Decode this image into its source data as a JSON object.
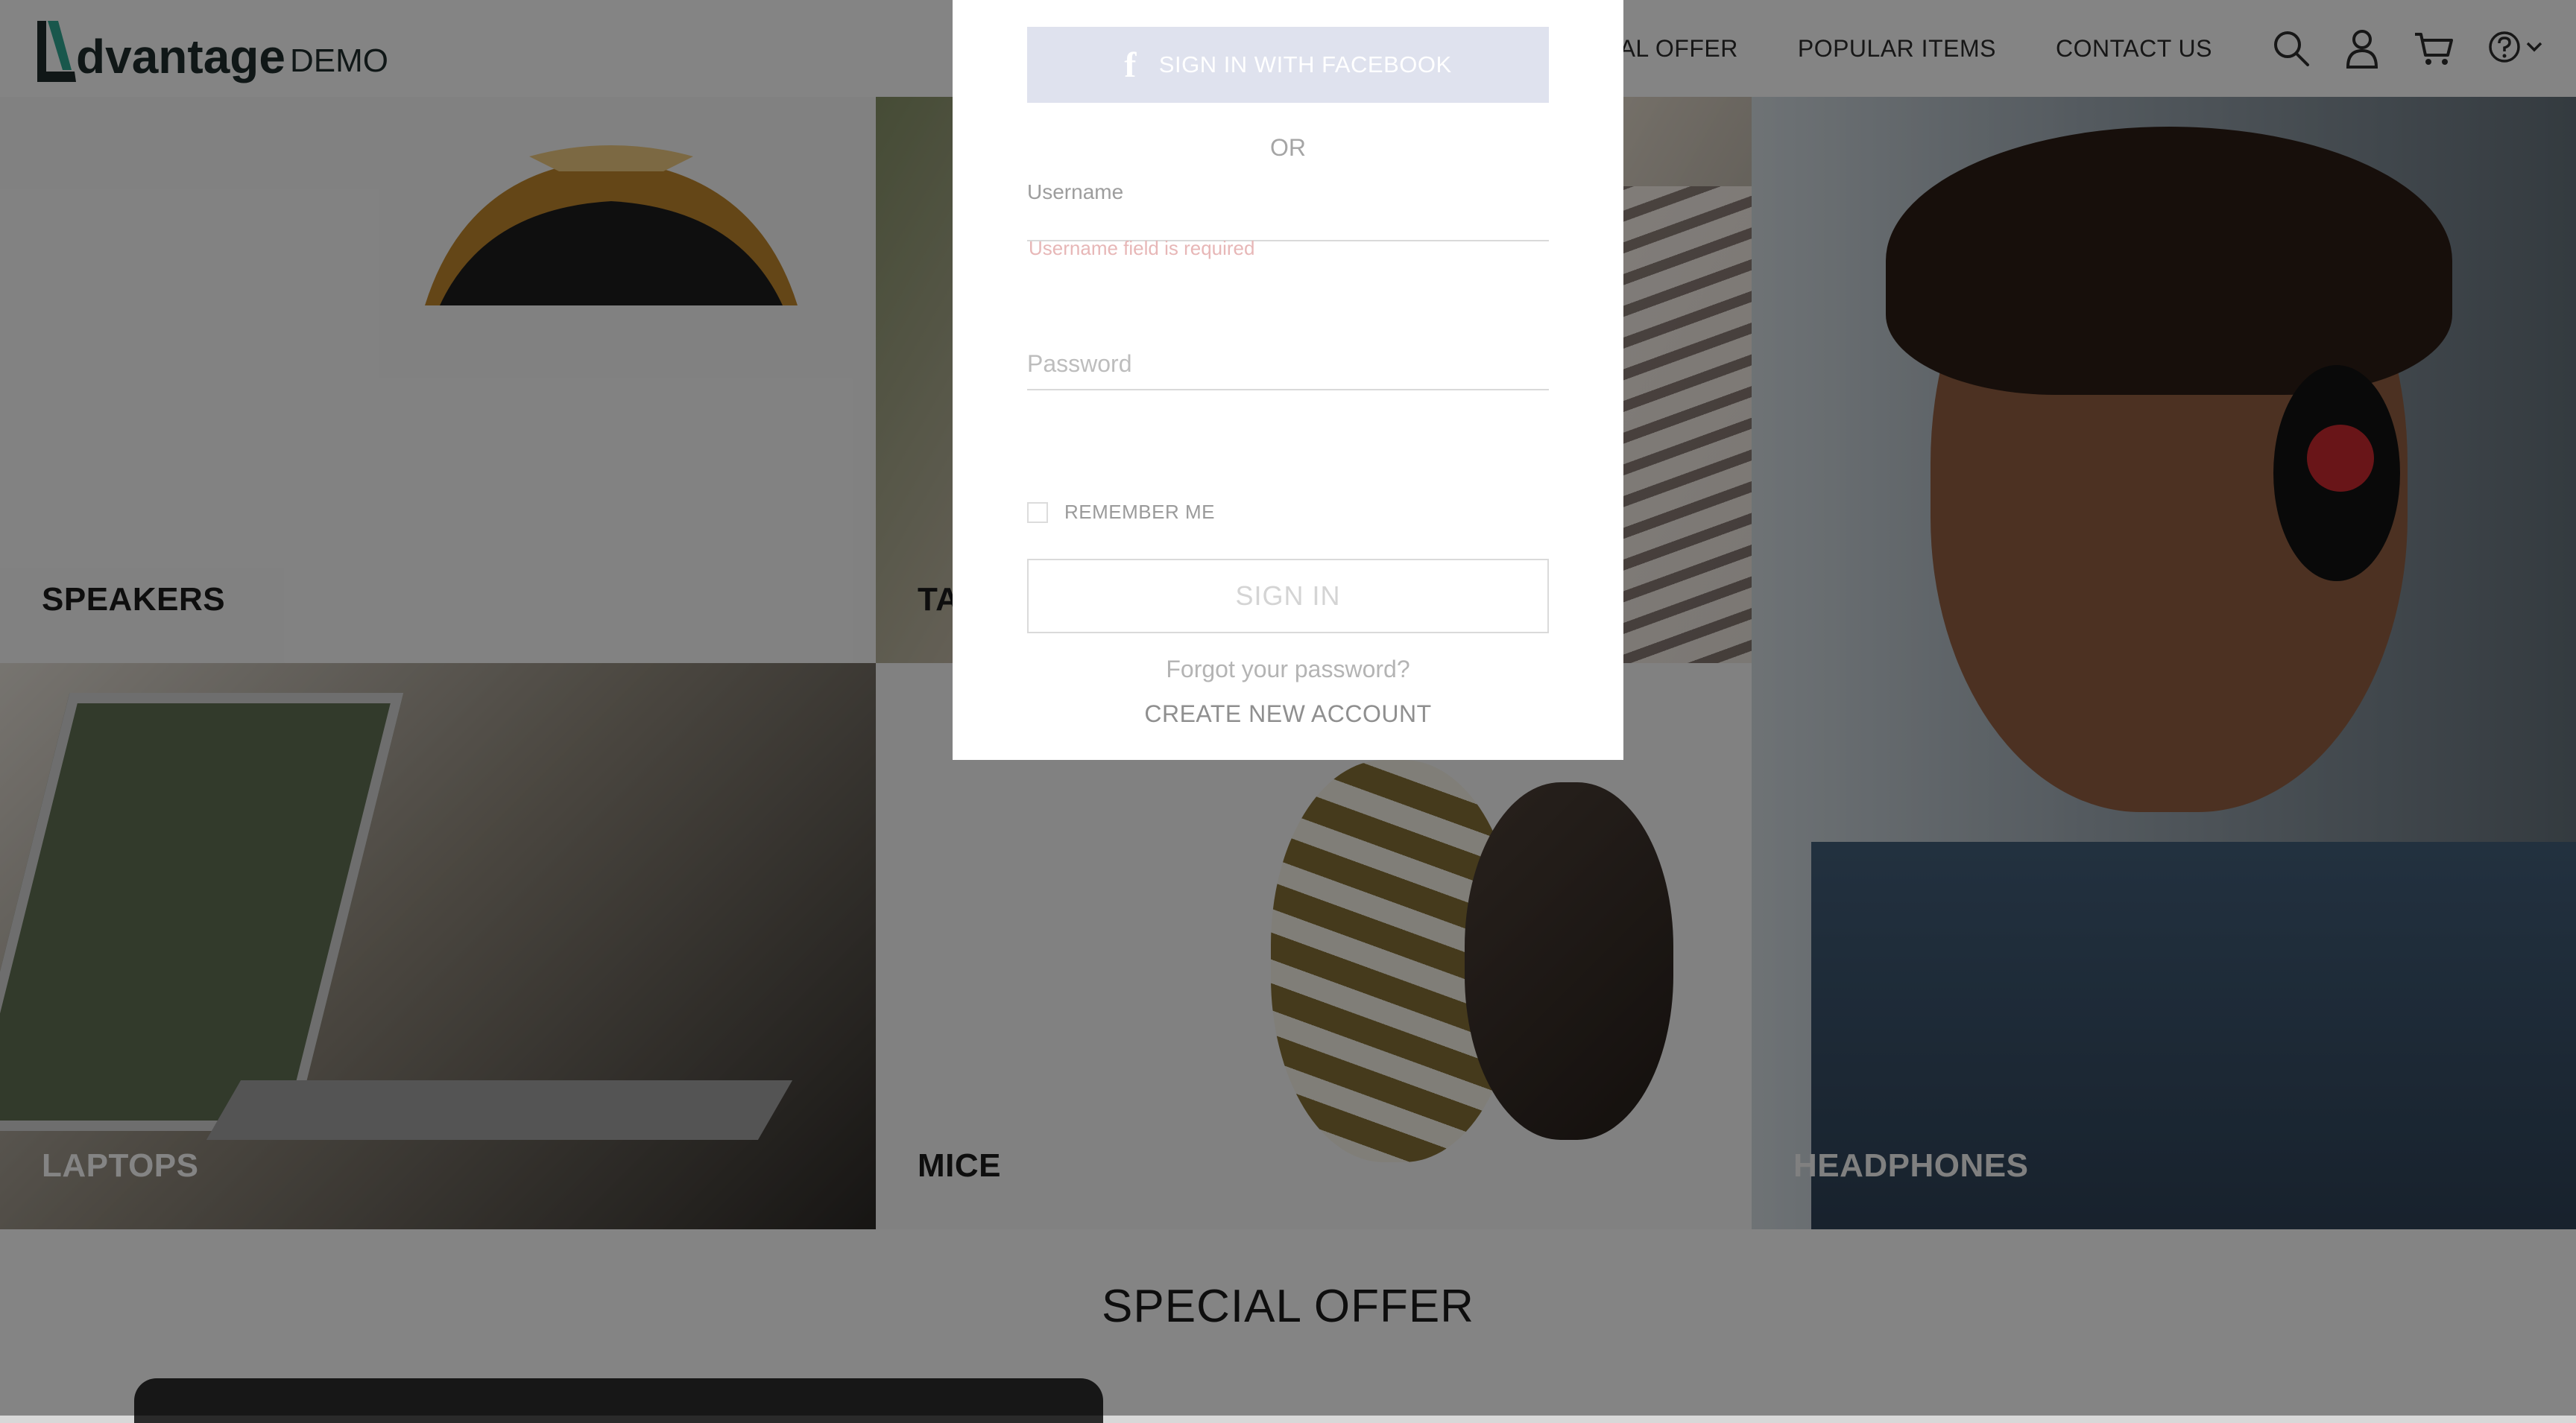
{
  "header": {
    "logo_word": "dvantage",
    "logo_suffix": "DEMO",
    "nav": [
      "SPECIAL OFFER",
      "POPULAR ITEMS",
      "CONTACT US"
    ],
    "icons": [
      "search-icon",
      "user-icon",
      "cart-icon",
      "help-icon",
      "chevron-down-icon"
    ]
  },
  "categories": {
    "speakers": "SPEAKERS",
    "tablets": "TABLETS",
    "headphones": "HEADPHONES",
    "laptops": "LAPTOPS",
    "mice": "MICE"
  },
  "special_offer": {
    "title": "SPECIAL OFFER"
  },
  "login_modal": {
    "facebook_button": "SIGN IN WITH FACEBOOK",
    "or_text": "OR",
    "username_label": "Username",
    "username_value": "",
    "username_error": "Username field is required",
    "password_placeholder": "Password",
    "remember_me": "REMEMBER ME",
    "remember_me_checked": false,
    "sign_in_button": "SIGN IN",
    "forgot_password": "Forgot your password?",
    "create_account": "CREATE NEW ACCOUNT"
  },
  "colors": {
    "brand_teal": "#2e9e8b",
    "facebook_button_bg": "#dfe2ee",
    "error_text": "#e7b7b7",
    "overlay": "rgba(0,0,0,0.45)"
  }
}
